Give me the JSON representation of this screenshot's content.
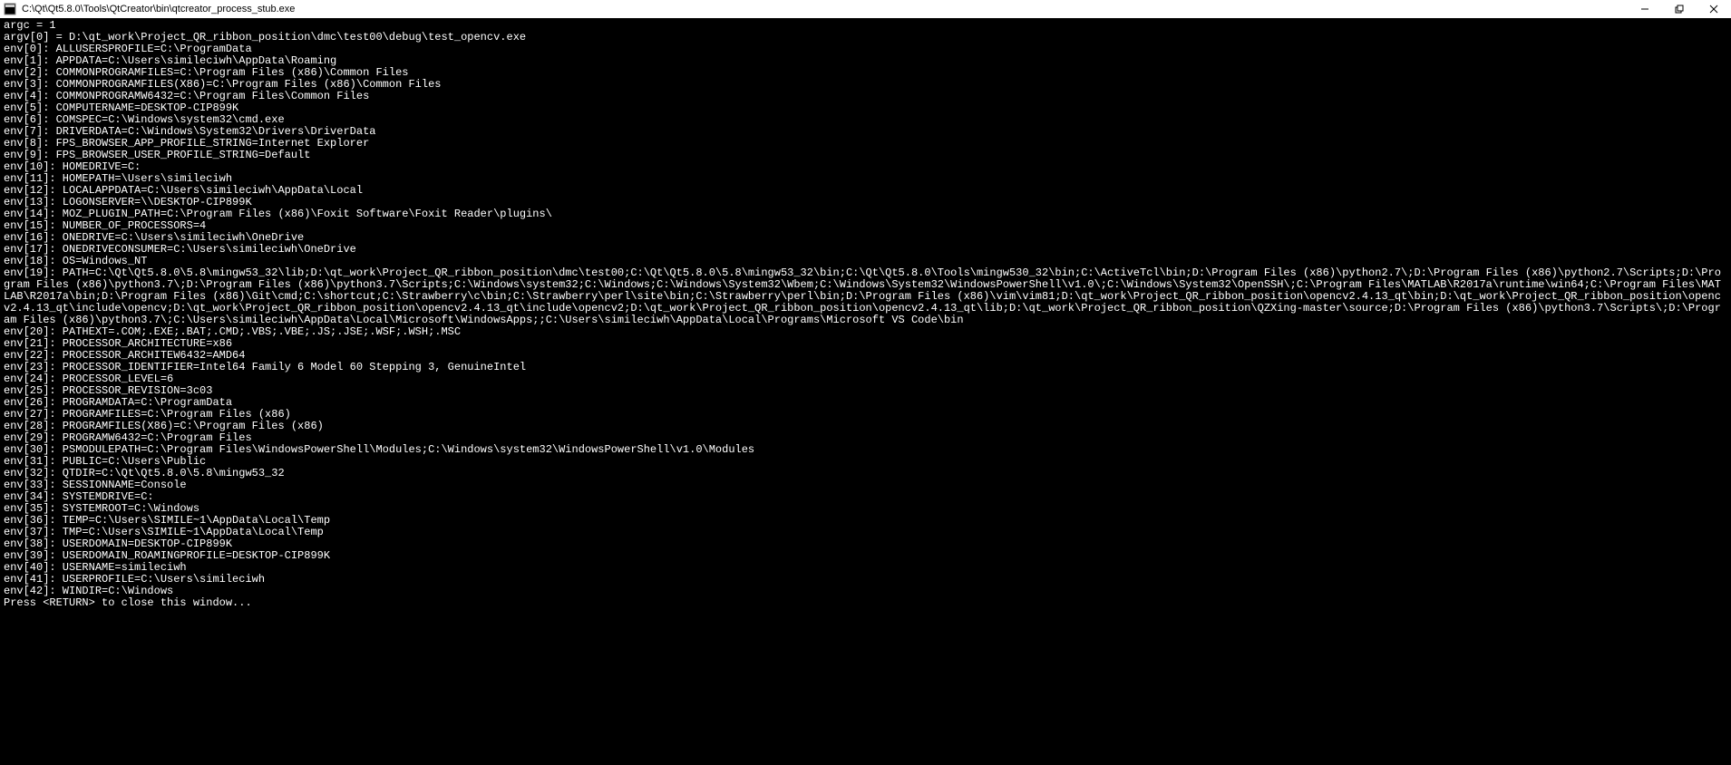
{
  "window": {
    "title": "C:\\Qt\\Qt5.8.0\\Tools\\QtCreator\\bin\\qtcreator_process_stub.exe"
  },
  "console": {
    "lines": [
      "argc = 1",
      "argv[0] = D:\\qt_work\\Project_QR_ribbon_position\\dmc\\test00\\debug\\test_opencv.exe",
      "env[0]: ALLUSERSPROFILE=C:\\ProgramData",
      "env[1]: APPDATA=C:\\Users\\simileciwh\\AppData\\Roaming",
      "env[2]: COMMONPROGRAMFILES=C:\\Program Files (x86)\\Common Files",
      "env[3]: COMMONPROGRAMFILES(X86)=C:\\Program Files (x86)\\Common Files",
      "env[4]: COMMONPROGRAMW6432=C:\\Program Files\\Common Files",
      "env[5]: COMPUTERNAME=DESKTOP-CIP899K",
      "env[6]: COMSPEC=C:\\Windows\\system32\\cmd.exe",
      "env[7]: DRIVERDATA=C:\\Windows\\System32\\Drivers\\DriverData",
      "env[8]: FPS_BROWSER_APP_PROFILE_STRING=Internet Explorer",
      "env[9]: FPS_BROWSER_USER_PROFILE_STRING=Default",
      "env[10]: HOMEDRIVE=C:",
      "env[11]: HOMEPATH=\\Users\\simileciwh",
      "env[12]: LOCALAPPDATA=C:\\Users\\simileciwh\\AppData\\Local",
      "env[13]: LOGONSERVER=\\\\DESKTOP-CIP899K",
      "env[14]: MOZ_PLUGIN_PATH=C:\\Program Files (x86)\\Foxit Software\\Foxit Reader\\plugins\\",
      "env[15]: NUMBER_OF_PROCESSORS=4",
      "env[16]: ONEDRIVE=C:\\Users\\simileciwh\\OneDrive",
      "env[17]: ONEDRIVECONSUMER=C:\\Users\\simileciwh\\OneDrive",
      "env[18]: OS=Windows_NT",
      "env[19]: PATH=C:\\Qt\\Qt5.8.0\\5.8\\mingw53_32\\lib;D:\\qt_work\\Project_QR_ribbon_position\\dmc\\test00;C:\\Qt\\Qt5.8.0\\5.8\\mingw53_32\\bin;C:\\Qt\\Qt5.8.0\\Tools\\mingw530_32\\bin;C:\\ActiveTcl\\bin;D:\\Program Files (x86)\\python2.7\\;D:\\Program Files (x86)\\python2.7\\Scripts;D:\\Program Files (x86)\\python3.7\\;D:\\Program Files (x86)\\python3.7\\Scripts;C:\\Windows\\system32;C:\\Windows;C:\\Windows\\System32\\Wbem;C:\\Windows\\System32\\WindowsPowerShell\\v1.0\\;C:\\Windows\\System32\\OpenSSH\\;C:\\Program Files\\MATLAB\\R2017a\\runtime\\win64;C:\\Program Files\\MATLAB\\R2017a\\bin;D:\\Program Files (x86)\\Git\\cmd;C:\\shortcut;C:\\Strawberry\\c\\bin;C:\\Strawberry\\perl\\site\\bin;C:\\Strawberry\\perl\\bin;D:\\Program Files (x86)\\vim\\vim81;D:\\qt_work\\Project_QR_ribbon_position\\opencv2.4.13_qt\\bin;D:\\qt_work\\Project_QR_ribbon_position\\opencv2.4.13_qt\\include\\opencv;D:\\qt_work\\Project_QR_ribbon_position\\opencv2.4.13_qt\\include\\opencv2;D:\\qt_work\\Project_QR_ribbon_position\\opencv2.4.13_qt\\lib;D:\\qt_work\\Project_QR_ribbon_position\\QZXing-master\\source;D:\\Program Files (x86)\\python3.7\\Scripts\\;D:\\Program Files (x86)\\python3.7\\;C:\\Users\\simileciwh\\AppData\\Local\\Microsoft\\WindowsApps;;C:\\Users\\simileciwh\\AppData\\Local\\Programs\\Microsoft VS Code\\bin",
      "env[20]: PATHEXT=.COM;.EXE;.BAT;.CMD;.VBS;.VBE;.JS;.JSE;.WSF;.WSH;.MSC",
      "env[21]: PROCESSOR_ARCHITECTURE=x86",
      "env[22]: PROCESSOR_ARCHITEW6432=AMD64",
      "env[23]: PROCESSOR_IDENTIFIER=Intel64 Family 6 Model 60 Stepping 3, GenuineIntel",
      "env[24]: PROCESSOR_LEVEL=6",
      "env[25]: PROCESSOR_REVISION=3c03",
      "env[26]: PROGRAMDATA=C:\\ProgramData",
      "env[27]: PROGRAMFILES=C:\\Program Files (x86)",
      "env[28]: PROGRAMFILES(X86)=C:\\Program Files (x86)",
      "env[29]: PROGRAMW6432=C:\\Program Files",
      "env[30]: PSMODULEPATH=C:\\Program Files\\WindowsPowerShell\\Modules;C:\\Windows\\system32\\WindowsPowerShell\\v1.0\\Modules",
      "env[31]: PUBLIC=C:\\Users\\Public",
      "env[32]: QTDIR=C:\\Qt\\Qt5.8.0\\5.8\\mingw53_32",
      "env[33]: SESSIONNAME=Console",
      "env[34]: SYSTEMDRIVE=C:",
      "env[35]: SYSTEMROOT=C:\\Windows",
      "env[36]: TEMP=C:\\Users\\SIMILE~1\\AppData\\Local\\Temp",
      "env[37]: TMP=C:\\Users\\SIMILE~1\\AppData\\Local\\Temp",
      "env[38]: USERDOMAIN=DESKTOP-CIP899K",
      "env[39]: USERDOMAIN_ROAMINGPROFILE=DESKTOP-CIP899K",
      "env[40]: USERNAME=simileciwh",
      "env[41]: USERPROFILE=C:\\Users\\simileciwh",
      "env[42]: WINDIR=C:\\Windows",
      "Press <RETURN> to close this window..."
    ]
  }
}
